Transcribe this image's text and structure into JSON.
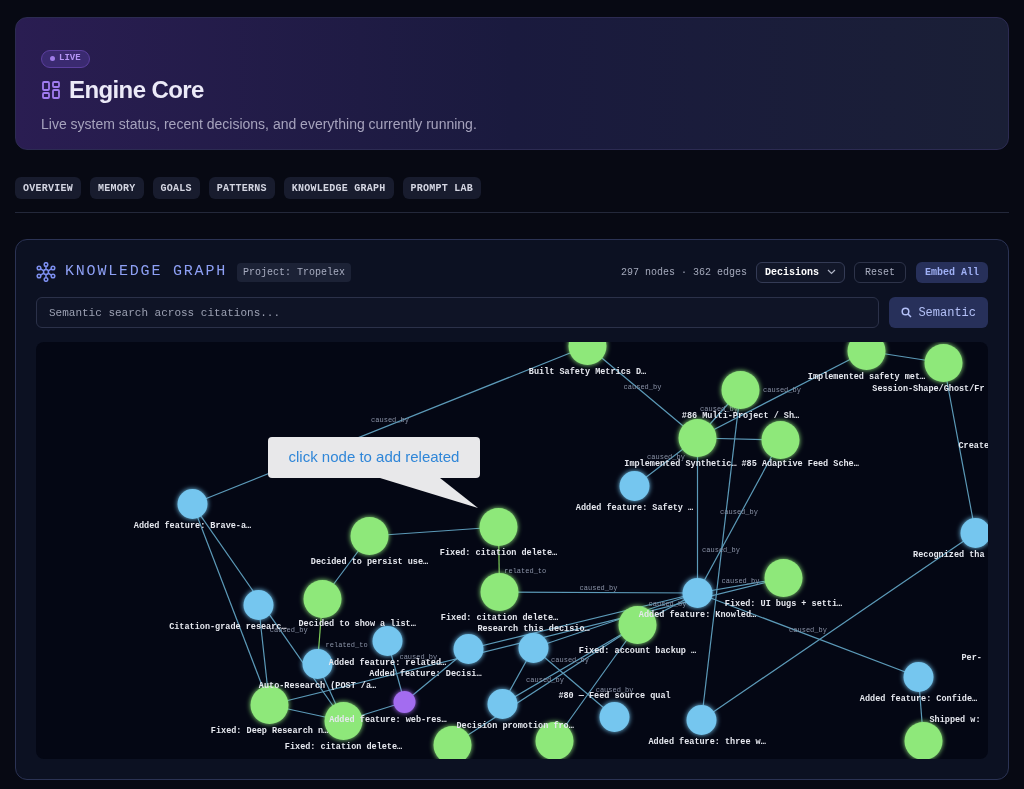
{
  "header": {
    "badge": "LIVE",
    "title": "Engine Core",
    "subtitle": "Live system status, recent decisions, and everything currently running."
  },
  "tabs": [
    {
      "label": "OVERVIEW"
    },
    {
      "label": "MEMORY"
    },
    {
      "label": "GOALS"
    },
    {
      "label": "PATTERNS"
    },
    {
      "label": "KNOWLEDGE GRAPH"
    },
    {
      "label": "PROMPT LAB"
    }
  ],
  "panel": {
    "title": "KNOWLEDGE GRAPH",
    "project": "Project: Tropelex",
    "stats": "297 nodes · 362 edges",
    "filter": "Decisions",
    "reset": "Reset",
    "embed": "Embed All",
    "search": {
      "placeholder": "Semantic search across citations..."
    },
    "search_button": "Semantic",
    "tooltip": "click node to add releated",
    "nodes": [
      {
        "kind": "decision",
        "label": "Built Safety Metrics D…"
      },
      {
        "kind": "decision",
        "label": "Implemented safety met…"
      },
      {
        "kind": "decision",
        "label": "Session-Shape/Ghost/Fr"
      },
      {
        "kind": "decision",
        "label": "#86 Multi-Project / Sh…"
      },
      {
        "kind": "decision",
        "label": "Implemented Synthetic…"
      },
      {
        "kind": "decision",
        "label": "#85 Adaptive Feed Sche…"
      },
      {
        "kind": "partial",
        "label": "Create"
      },
      {
        "kind": "feature",
        "label": "Added feature: Safety …"
      },
      {
        "kind": "feature",
        "label": "Added feature: Brave-a…"
      },
      {
        "kind": "decision",
        "label": "Decided to persist use…"
      },
      {
        "kind": "decision",
        "label": "Fixed: citation delete…"
      },
      {
        "kind": "feature",
        "label": "Recognized tha"
      },
      {
        "kind": "decision",
        "label": "Fixed: citation delete…"
      },
      {
        "kind": "feature",
        "label": "Added feature: Knowled…"
      },
      {
        "kind": "decision",
        "label": "Fixed: UI bugs + setti…"
      },
      {
        "kind": "feature",
        "label": "Citation-grade researc…"
      },
      {
        "kind": "decision",
        "label": "Decided to show a list…"
      },
      {
        "kind": "decision",
        "label": "Fixed: account backup …"
      },
      {
        "kind": "feature",
        "label": "Added feature: related…"
      },
      {
        "kind": "feature",
        "label": "Added feature: Decisi…"
      },
      {
        "kind": "feature",
        "label": "Research this decisio…"
      },
      {
        "kind": "feature",
        "label": "Auto-Research (POST /a…"
      },
      {
        "kind": "partial",
        "label": "Per-"
      },
      {
        "kind": "feature",
        "label": "Added feature: Confide…"
      },
      {
        "kind": "decision",
        "label": "Fixed: Deep Research n…"
      },
      {
        "kind": "research",
        "label": "Added feature: web-res…"
      },
      {
        "kind": "feature",
        "label": "Decision promotion fro…"
      },
      {
        "kind": "decision",
        "label": "Fixed: citation delete…"
      },
      {
        "kind": "feature",
        "label": "#80 — Feed source qual"
      },
      {
        "kind": "feature",
        "label": "Added feature: three w…"
      },
      {
        "kind": "decision"
      },
      {
        "kind": "decision"
      },
      {
        "kind": "decision"
      },
      {
        "kind": "partial",
        "label": "Shipped w:"
      }
    ],
    "edges": [
      {
        "kind": "cause",
        "label": "caused_by"
      },
      {
        "kind": "cause",
        "label": "caused_by"
      },
      {
        "kind": "cause"
      },
      {
        "kind": "cause",
        "label": "caused_by"
      },
      {
        "kind": "cause",
        "label": "caused_by"
      },
      {
        "kind": "cause"
      },
      {
        "kind": "cause",
        "label": "caused_by"
      },
      {
        "kind": "cause",
        "label": "caused_by"
      },
      {
        "kind": "cause"
      },
      {
        "kind": "cause"
      },
      {
        "kind": "cause",
        "label": "caused_by"
      },
      {
        "kind": "related",
        "label": "related_to"
      },
      {
        "kind": "cause"
      },
      {
        "kind": "cause",
        "label": "caused_by"
      },
      {
        "kind": "cause",
        "label": "caused_by"
      },
      {
        "kind": "cause",
        "label": "caused_by"
      },
      {
        "kind": "cause",
        "label": "caused_by"
      },
      {
        "kind": "cause"
      },
      {
        "kind": "cause"
      },
      {
        "kind": "cause",
        "label": "caused_by"
      },
      {
        "kind": "cause",
        "label": "caused_by"
      },
      {
        "kind": "cause",
        "label": "caused_by"
      },
      {
        "kind": "related",
        "label": "related_to"
      },
      {
        "kind": "cause"
      },
      {
        "kind": "cause"
      },
      {
        "kind": "cause"
      },
      {
        "kind": "cause"
      },
      {
        "kind": "cause",
        "label": "caused_by"
      },
      {
        "kind": "cause"
      },
      {
        "kind": "cause"
      },
      {
        "kind": "cause"
      },
      {
        "kind": "cause"
      },
      {
        "kind": "cause"
      },
      {
        "kind": "cause"
      },
      {
        "kind": "cause"
      },
      {
        "kind": "cause"
      },
      {
        "kind": "cause",
        "label": "caused_by"
      }
    ]
  }
}
